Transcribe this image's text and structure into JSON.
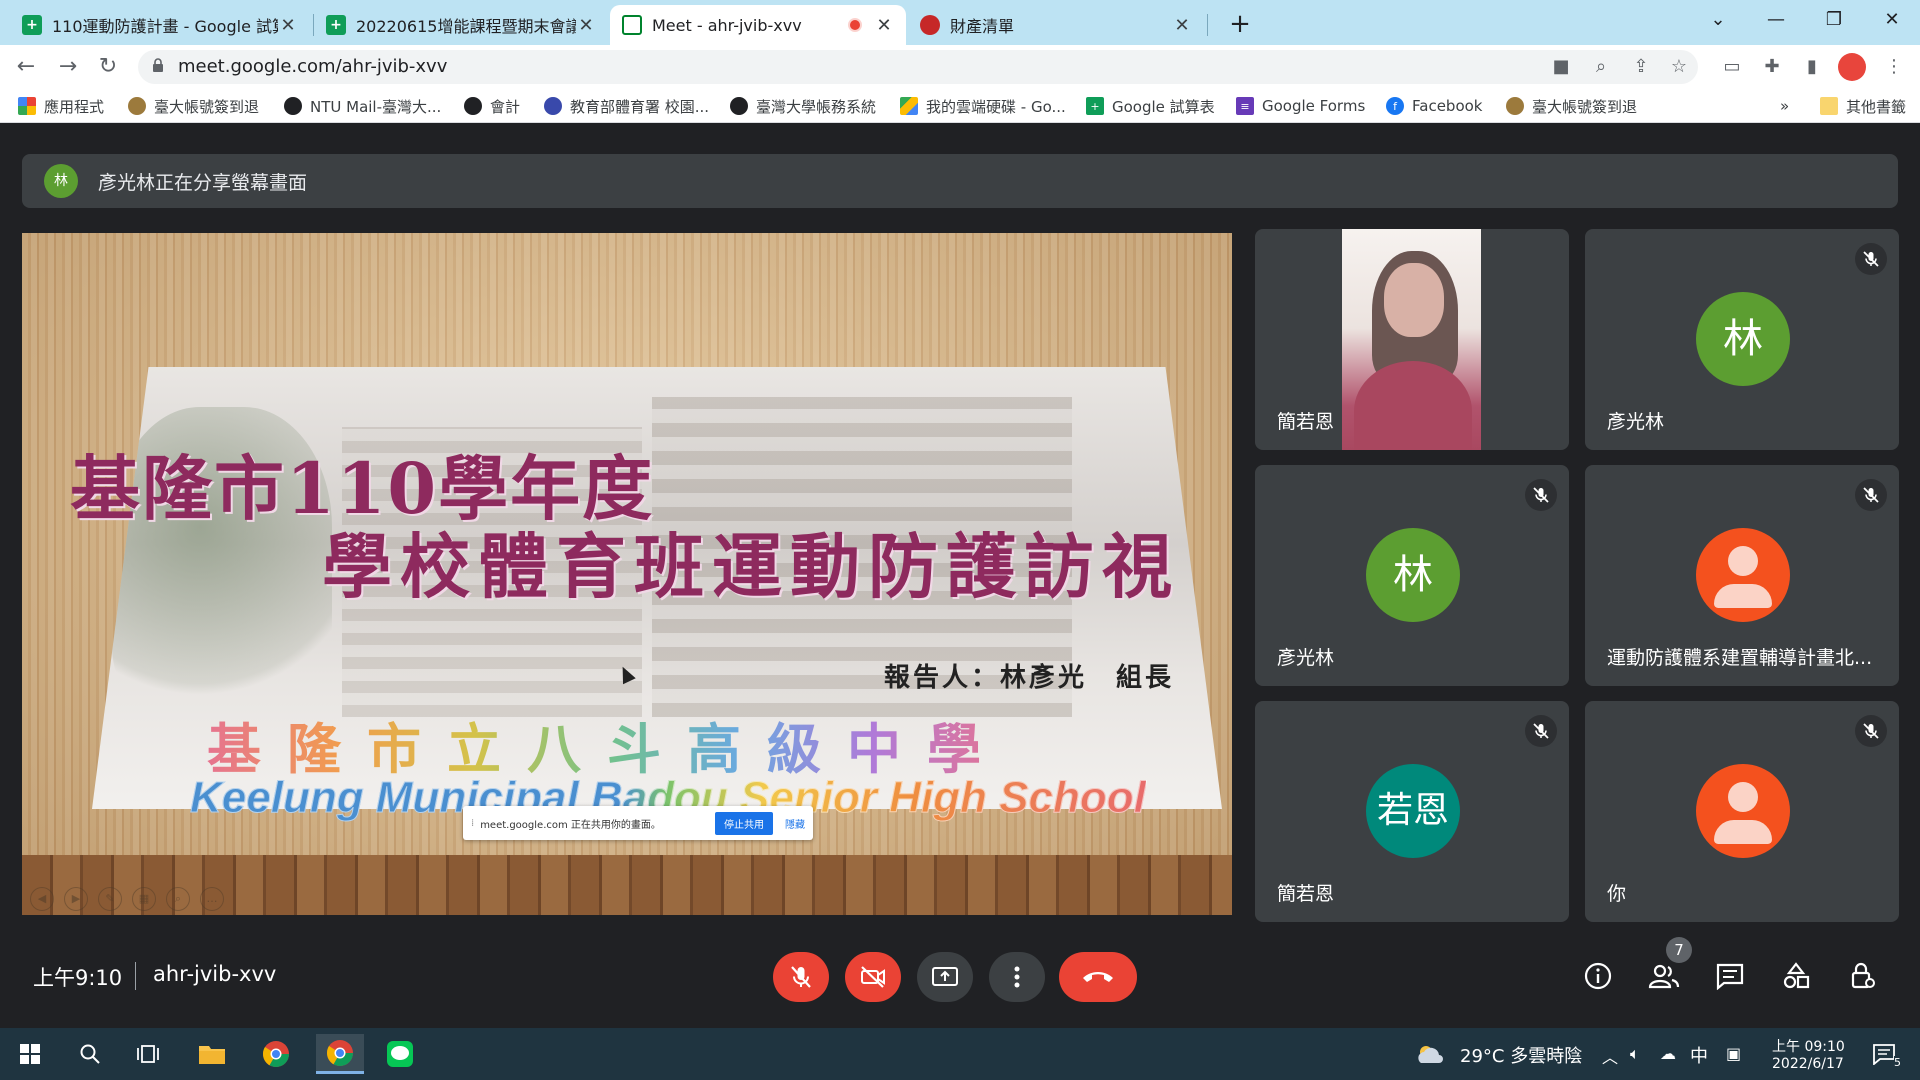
{
  "browser": {
    "tabs": [
      {
        "title": "110運動防護計畫 - Google 試算",
        "favicon": "sheets-icon"
      },
      {
        "title": "20220615增能課程暨期末會議簽",
        "favicon": "sheets-icon"
      },
      {
        "title": "Meet - ahr-jvib-xvv",
        "favicon": "meet-icon",
        "active": true,
        "recording": true
      },
      {
        "title": "財產清單",
        "favicon": "web-icon"
      }
    ],
    "url": "meet.google.com/ahr-jvib-xvv",
    "bookmarks": [
      {
        "label": "應用程式",
        "icon": "apps-grid-icon"
      },
      {
        "label": "臺大帳號簽到退",
        "icon": "ntu-seal-icon"
      },
      {
        "label": "NTU Mail-臺灣大...",
        "icon": "globe-icon"
      },
      {
        "label": "會計",
        "icon": "globe-icon"
      },
      {
        "label": "教育部體育署 校園...",
        "icon": "moe-icon"
      },
      {
        "label": "臺灣大學帳務系統",
        "icon": "globe-icon"
      },
      {
        "label": "我的雲端硬碟 - Go...",
        "icon": "drive-icon"
      },
      {
        "label": "Google 試算表",
        "icon": "sheets-icon"
      },
      {
        "label": "Google Forms",
        "icon": "forms-icon"
      },
      {
        "label": "Facebook",
        "icon": "facebook-icon"
      },
      {
        "label": "臺大帳號簽到退",
        "icon": "ntu-seal-icon"
      }
    ],
    "more_bookmarks": "»",
    "other_bookmarks": "其他書籤"
  },
  "meet": {
    "share_banner": {
      "avatar_initial": "林",
      "text": "彥光林正在分享螢幕畫面"
    },
    "slide": {
      "title_line1": "基隆市110學年度",
      "title_line2": "學校體育班運動防護訪視",
      "reporter": "報告人：林彥光　組長",
      "school_zh": "基隆市立八斗高級中學",
      "school_en": "Keelung Municipal Badou Senior High School",
      "share_popup": {
        "message": "meet.google.com 正在共用你的畫面。",
        "stop_label": "停止共用",
        "hide_label": "隱藏"
      }
    },
    "participants": [
      {
        "name": "簡若恩",
        "type": "video",
        "muted": false
      },
      {
        "name": "彥光林",
        "type": "initial",
        "initial": "林",
        "color": "#5c9e31",
        "muted": true
      },
      {
        "name": "彥光林",
        "type": "initial",
        "initial": "林",
        "color": "#5c9e31",
        "muted": true
      },
      {
        "name": "運動防護體系建置輔導計畫北...",
        "type": "person",
        "color": "#f4511e",
        "muted": true
      },
      {
        "name": "簡若恩",
        "type": "initial",
        "initial": "若恩",
        "color": "#00897b",
        "muted": true
      },
      {
        "name": "你",
        "type": "person",
        "color": "#f4511e",
        "muted": true
      }
    ],
    "time": "上午9:10",
    "meeting_code": "ahr-jvib-xvv",
    "people_count": "7",
    "colors": {
      "danger": "#ea4335",
      "surface": "#3c4043",
      "background": "#202124"
    }
  },
  "taskbar": {
    "weather": "29°C 多雲時陰",
    "ime": "中",
    "time": "上午 09:10",
    "date": "2022/6/17",
    "notifications": "5"
  }
}
